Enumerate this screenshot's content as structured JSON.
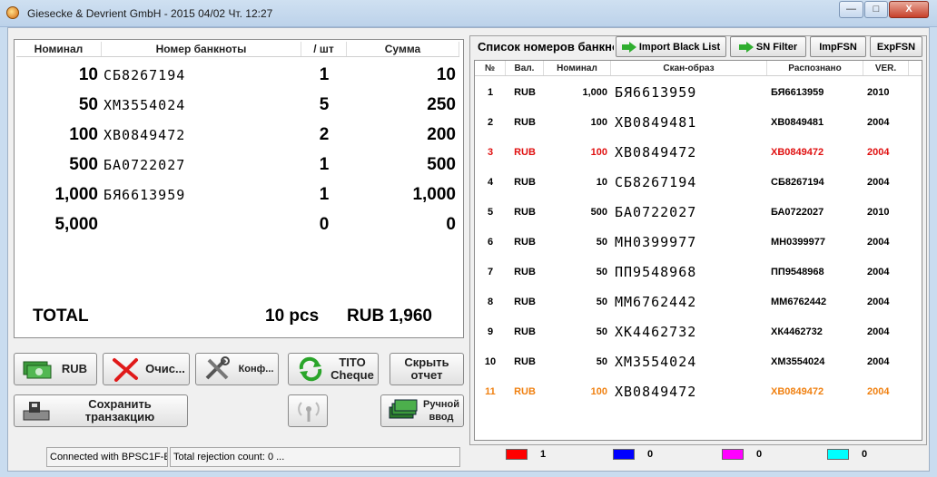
{
  "window": {
    "title": "Giesecke & Devrient GmbH  -  2015 04/02 Чт. 12:27",
    "min": "—",
    "max": "□",
    "close": "X"
  },
  "left_table": {
    "columns": [
      "Номинал",
      "Номер банкноты",
      "/ шт",
      "Сумма"
    ],
    "rows": [
      {
        "nominal": "10",
        "serial": "СБ8267194",
        "count": "1",
        "sum": "10"
      },
      {
        "nominal": "50",
        "serial": "ХМ3554024",
        "count": "5",
        "sum": "250"
      },
      {
        "nominal": "100",
        "serial": "ХВ0849472",
        "count": "2",
        "sum": "200"
      },
      {
        "nominal": "500",
        "serial": "БА0722027",
        "count": "1",
        "sum": "500"
      },
      {
        "nominal": "1,000",
        "serial": "БЯ6613959",
        "count": "1",
        "sum": "1,000"
      },
      {
        "nominal": "5,000",
        "serial": "",
        "count": "0",
        "sum": "0"
      }
    ],
    "total_label": "TOTAL",
    "total_pcs": "10 pcs",
    "total_sum": "RUB 1,960"
  },
  "buttons": {
    "rub": "RUB",
    "clear": "Очис...",
    "config": "Конф...",
    "tito": "TITO Cheque",
    "hide_report": "Скрыть отчет",
    "save_tx": "Сохранить транзакцию",
    "manual": "Ручной ввод"
  },
  "right_panel": {
    "title": "Список номеров банкнот",
    "import_black_list": "Import Black List",
    "sn_filter": "SN Filter",
    "imp_fsn": "ImpFSN",
    "exp_fsn": "ExpFSN",
    "columns": [
      "№",
      "Вал.",
      "Номинал",
      "Скан-образ",
      "Распознано",
      "VER."
    ],
    "rows": [
      {
        "no": "1",
        "cur": "RUB",
        "nominal": "1,000",
        "scan": "БЯ6613959",
        "recognized": "БЯ6613959",
        "ver": "2010",
        "color": "#000000"
      },
      {
        "no": "2",
        "cur": "RUB",
        "nominal": "100",
        "scan": "ХВ0849481",
        "recognized": "ХВ0849481",
        "ver": "2004",
        "color": "#000000"
      },
      {
        "no": "3",
        "cur": "RUB",
        "nominal": "100",
        "scan": "ХВ0849472",
        "recognized": "ХВ0849472",
        "ver": "2004",
        "color": "#e01010"
      },
      {
        "no": "4",
        "cur": "RUB",
        "nominal": "10",
        "scan": "СБ8267194",
        "recognized": "СБ8267194",
        "ver": "2004",
        "color": "#000000"
      },
      {
        "no": "5",
        "cur": "RUB",
        "nominal": "500",
        "scan": "БА0722027",
        "recognized": "БА0722027",
        "ver": "2010",
        "color": "#000000"
      },
      {
        "no": "6",
        "cur": "RUB",
        "nominal": "50",
        "scan": "МН0399977",
        "recognized": "МН0399977",
        "ver": "2004",
        "color": "#000000"
      },
      {
        "no": "7",
        "cur": "RUB",
        "nominal": "50",
        "scan": "ПП9548968",
        "recognized": "ПП9548968",
        "ver": "2004",
        "color": "#000000"
      },
      {
        "no": "8",
        "cur": "RUB",
        "nominal": "50",
        "scan": "ММ6762442",
        "recognized": "ММ6762442",
        "ver": "2004",
        "color": "#000000"
      },
      {
        "no": "9",
        "cur": "RUB",
        "nominal": "50",
        "scan": "ХК4462732",
        "recognized": "ХК4462732",
        "ver": "2004",
        "color": "#000000"
      },
      {
        "no": "10",
        "cur": "RUB",
        "nominal": "50",
        "scan": "ХМ3554024",
        "recognized": "ХМ3554024",
        "ver": "2004",
        "color": "#000000"
      },
      {
        "no": "11",
        "cur": "RUB",
        "nominal": "100",
        "scan": "ХВ0849472",
        "recognized": "ХВ0849472",
        "ver": "2004",
        "color": "#f08010"
      }
    ]
  },
  "legend": [
    {
      "color": "#ff0000",
      "count": "1"
    },
    {
      "color": "#0000ff",
      "count": "0"
    },
    {
      "color": "#ff00ff",
      "count": "0"
    },
    {
      "color": "#00ffff",
      "count": "0"
    }
  ],
  "status": {
    "connection": "Connected with BPSC1F-E",
    "rejection": "Total rejection count: 0 ..."
  }
}
